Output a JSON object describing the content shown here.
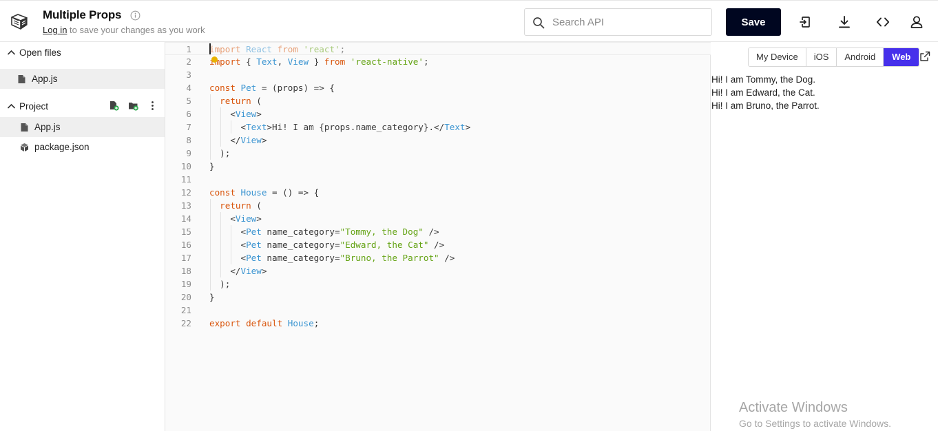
{
  "header": {
    "title": "Multiple Props",
    "login_link": "Log in",
    "login_suffix": " to save your changes as you work",
    "search_placeholder": "Search API",
    "save_label": "Save"
  },
  "sidebar": {
    "open_files_label": "Open files",
    "open_files": [
      {
        "name": "App.js"
      }
    ],
    "project_label": "Project",
    "project_files": [
      {
        "name": "App.js"
      },
      {
        "name": "package.json"
      }
    ]
  },
  "editor": {
    "line_numbers": [
      "1",
      "2",
      "3",
      "4",
      "5",
      "6",
      "7",
      "8",
      "9",
      "10",
      "11",
      "12",
      "13",
      "14",
      "15",
      "16",
      "17",
      "18",
      "19",
      "20",
      "21",
      "22"
    ],
    "lines": [
      [
        {
          "t": "import",
          "c": "kw"
        },
        {
          "t": " "
        },
        {
          "t": "React",
          "c": "fn"
        },
        {
          "t": " "
        },
        {
          "t": "from",
          "c": "kw"
        },
        {
          "t": " "
        },
        {
          "t": "'react'",
          "c": "str"
        },
        {
          "t": ";"
        }
      ],
      [
        {
          "t": "import",
          "c": "kw"
        },
        {
          "t": " { "
        },
        {
          "t": "Text",
          "c": "fn"
        },
        {
          "t": ", "
        },
        {
          "t": "View",
          "c": "fn"
        },
        {
          "t": " } "
        },
        {
          "t": "from",
          "c": "kw"
        },
        {
          "t": " "
        },
        {
          "t": "'react-native'",
          "c": "str"
        },
        {
          "t": ";"
        }
      ],
      [],
      [
        {
          "t": "const",
          "c": "kw"
        },
        {
          "t": " "
        },
        {
          "t": "Pet",
          "c": "fn"
        },
        {
          "t": " = (props) => {"
        }
      ],
      [
        {
          "t": "  "
        },
        {
          "t": "return",
          "c": "kw"
        },
        {
          "t": " ("
        }
      ],
      [
        {
          "t": "    <"
        },
        {
          "t": "View",
          "c": "fn"
        },
        {
          "t": ">"
        }
      ],
      [
        {
          "t": "      <"
        },
        {
          "t": "Text",
          "c": "fn"
        },
        {
          "t": ">Hi! I am {props.name_category}.</"
        },
        {
          "t": "Text",
          "c": "fn"
        },
        {
          "t": ">"
        }
      ],
      [
        {
          "t": "    </"
        },
        {
          "t": "View",
          "c": "fn"
        },
        {
          "t": ">"
        }
      ],
      [
        {
          "t": "  );"
        }
      ],
      [
        {
          "t": "}"
        }
      ],
      [],
      [
        {
          "t": "const",
          "c": "kw"
        },
        {
          "t": " "
        },
        {
          "t": "House",
          "c": "fn"
        },
        {
          "t": " = () => {"
        }
      ],
      [
        {
          "t": "  "
        },
        {
          "t": "return",
          "c": "kw"
        },
        {
          "t": " ("
        }
      ],
      [
        {
          "t": "    <"
        },
        {
          "t": "View",
          "c": "fn"
        },
        {
          "t": ">"
        }
      ],
      [
        {
          "t": "      <"
        },
        {
          "t": "Pet",
          "c": "fn"
        },
        {
          "t": " name_category="
        },
        {
          "t": "\"Tommy, the Dog\"",
          "c": "str"
        },
        {
          "t": " />"
        }
      ],
      [
        {
          "t": "      <"
        },
        {
          "t": "Pet",
          "c": "fn"
        },
        {
          "t": " name_category="
        },
        {
          "t": "\"Edward, the Cat\"",
          "c": "str"
        },
        {
          "t": " />"
        }
      ],
      [
        {
          "t": "      <"
        },
        {
          "t": "Pet",
          "c": "fn"
        },
        {
          "t": " name_category="
        },
        {
          "t": "\"Bruno, the Parrot\"",
          "c": "str"
        },
        {
          "t": " />"
        }
      ],
      [
        {
          "t": "    </"
        },
        {
          "t": "View",
          "c": "fn"
        },
        {
          "t": ">"
        }
      ],
      [
        {
          "t": "  );"
        }
      ],
      [
        {
          "t": "}"
        }
      ],
      [],
      [
        {
          "t": "export",
          "c": "kw"
        },
        {
          "t": " "
        },
        {
          "t": "default",
          "c": "kw"
        },
        {
          "t": " "
        },
        {
          "t": "House",
          "c": "fn"
        },
        {
          "t": ";"
        }
      ]
    ]
  },
  "preview": {
    "tabs": [
      {
        "label": "My Device",
        "active": false
      },
      {
        "label": "iOS",
        "active": false
      },
      {
        "label": "Android",
        "active": false
      },
      {
        "label": "Web",
        "active": true
      }
    ],
    "output": [
      "Hi! I am Tommy, the Dog.",
      "Hi! I am Edward, the Cat.",
      "Hi! I am Bruno, the Parrot."
    ]
  },
  "watermark": {
    "line1": "Activate Windows",
    "line2": "Go to Settings to activate Windows."
  },
  "colors": {
    "keyword": "#d9550c",
    "identifier": "#3a94d1",
    "string": "#64a314",
    "accent": "#4630eb",
    "save_bg": "#000620"
  },
  "icons": [
    "snack-logo-icon",
    "info-icon",
    "search-icon",
    "device-icon",
    "download-icon",
    "code-icon",
    "user-icon",
    "chevron-up-icon",
    "file-js-icon",
    "add-file-icon",
    "add-folder-icon",
    "more-vertical-icon",
    "package-icon",
    "lightbulb-icon",
    "external-link-icon"
  ]
}
